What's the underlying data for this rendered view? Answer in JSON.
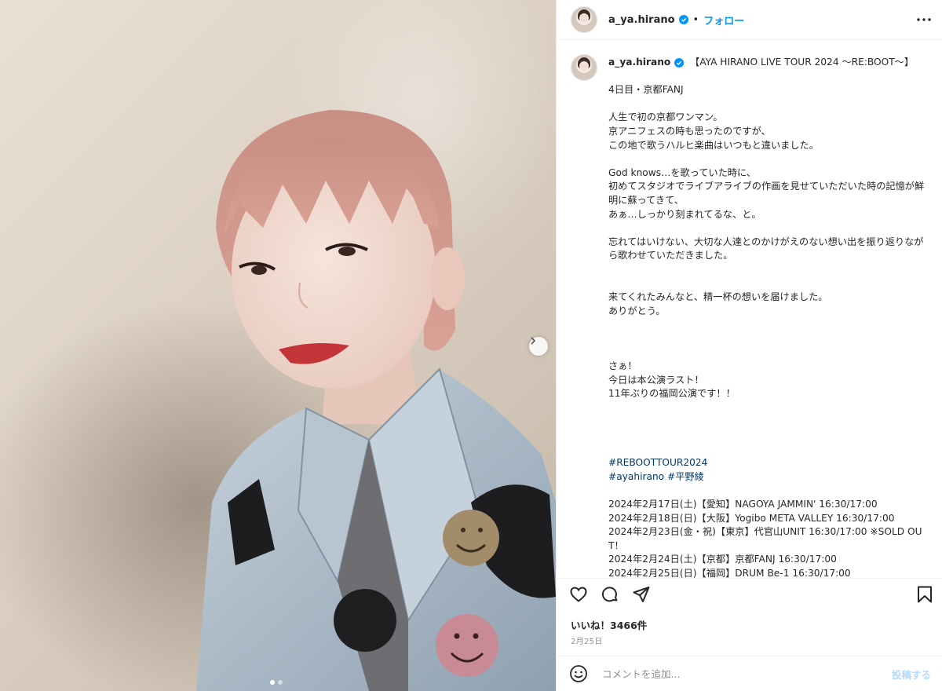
{
  "post": {
    "username": "a_ya.hirano",
    "follow_label": "フォロー",
    "separator": "•",
    "caption": {
      "headline": "【AYA HIRANO LIVE TOUR 2024 〜RE:BOOT〜】",
      "paragraphs": [
        "4日目・京都FANJ",
        "人生で初の京都ワンマン。\n京アニフェスの時も思ったのですが、\nこの地で歌うハルヒ楽曲はいつもと違いました。",
        "God knows…を歌っていた時に、\n初めてスタジオでライブアライブの作画を見せていただいた時の記憶が鮮明に蘇ってきて、\nあぁ…しっかり刻まれてるな、と。",
        "忘れてはいけない、大切な人達とのかけがえのない想い出を振り返りながら歌わせていただきました。",
        "来てくれたみんなと、精一杯の想いを届けました。\nありがとう。",
        "さぁ！\n今日は本公演ラスト！\n11年ぶりの福岡公演です！！"
      ],
      "hashtags_line1": "#REBOOTTOUR2024",
      "hashtags_line2a": "#ayahirano",
      "hashtags_line2b": "#平野綾",
      "schedule": [
        "2024年2月17日(土)【愛知】NAGOYA JAMMIN' 16:30/17:00",
        "2024年2月18日(日)【大阪】Yogibo META VALLEY 16:30/17:00",
        "2024年2月23日(金・祝)【東京】代官山UNIT 16:30/17:00 ※SOLD OUT！",
        "2024年2月24日(土)【京都】京都FANJ 16:30/17:00",
        "2024年2月25日(日)【福岡】DRUM Be-1 16:30/17:00"
      ]
    },
    "likes": "いいね！3466件",
    "date": "2月25日",
    "comment": {
      "placeholder": "コメントを追加...",
      "post_label": "投稿する"
    },
    "carousel": {
      "total": 2,
      "current": 1
    }
  },
  "icons": {
    "verified": "verified-badge-icon",
    "more": "more-options-icon",
    "like": "heart-icon",
    "comment": "comment-icon",
    "share": "share-icon",
    "save": "bookmark-icon",
    "emoji": "emoji-icon",
    "next": "chevron-right-icon"
  },
  "colors": {
    "accent": "#0095f6",
    "hashtag": "#00376b",
    "muted": "#8e8e8e"
  }
}
